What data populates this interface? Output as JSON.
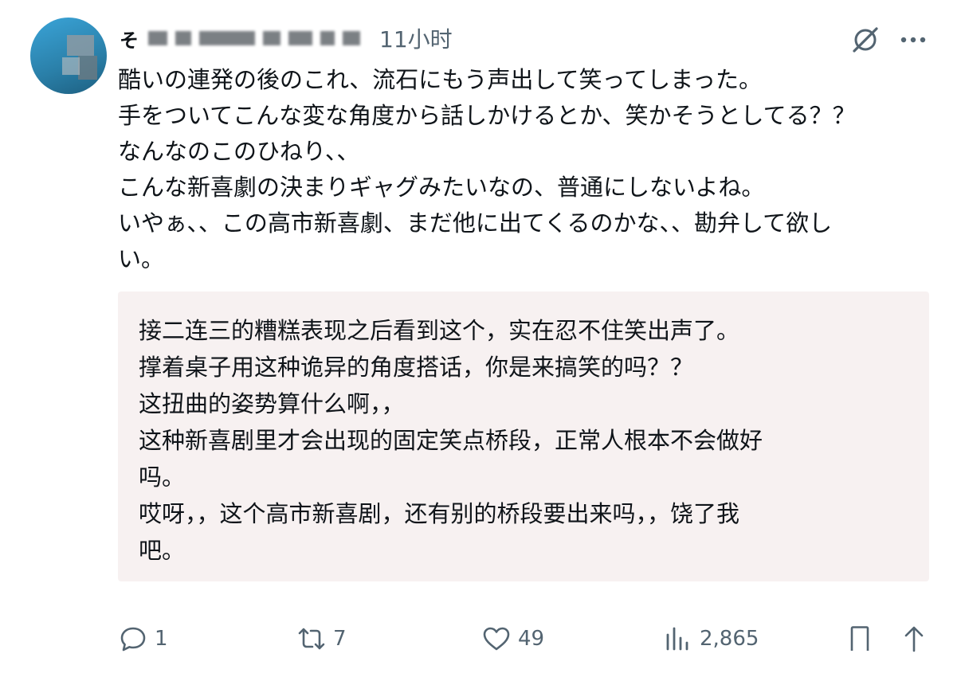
{
  "tweet": {
    "username": "そ",
    "timestamp": "11小时",
    "body_lines": [
      "酷いの連発の後のこれ、流石にもう声出して笑ってしまった。",
      "手をついてこんな変な角度から話しかけるとか、笑かそうとしてる？？",
      "なんなのこのひねり、、",
      "こんな新喜劇の決まりギャグみたいなの、普通にしないよね。",
      "いやぁ、、この高市新喜劇、まだ他に出てくるのかな、、勘弁して欲し",
      "い。"
    ],
    "translation_lines": [
      "接二连三的糟糕表现之后看到这个，实在忍不住笑出声了。",
      "撑着桌子用这种诡异的角度搭话，你是来搞笑的吗？？",
      "这扭曲的姿势算什么啊，，",
      "这种新喜剧里才会出现的固定笑点桥段，正常人根本不会做好",
      "吗。",
      "哎呀，，这个高市新喜剧，还有别的桥段要出来吗，，饶了我",
      "吧。"
    ]
  },
  "actions": {
    "reply": {
      "icon": "reply-icon",
      "count": "1"
    },
    "retweet": {
      "icon": "retweet-icon",
      "count": "7"
    },
    "like": {
      "icon": "heart-icon",
      "count": "49"
    },
    "views": {
      "icon": "views-icon",
      "count": "2,865"
    },
    "bookmark": {
      "icon": "bookmark-icon"
    },
    "share": {
      "icon": "share-icon"
    }
  },
  "colors": {
    "text": "#0f1419",
    "muted": "#536471",
    "translation_bg": "#f7f1f1"
  }
}
